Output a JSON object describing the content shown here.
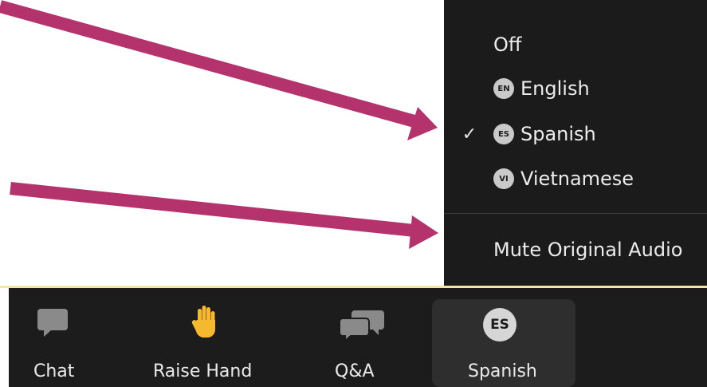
{
  "menu": {
    "items": [
      {
        "label": "Off",
        "badge": "",
        "checked": false
      },
      {
        "label": "English",
        "badge": "EN",
        "checked": false
      },
      {
        "label": "Spanish",
        "badge": "ES",
        "checked": true
      },
      {
        "label": "Vietnamese",
        "badge": "VI",
        "checked": false
      }
    ],
    "mute_label": "Mute Original Audio",
    "check_glyph": "✓"
  },
  "toolbar": {
    "chat_label": "Chat",
    "raise_hand_label": "Raise Hand",
    "qa_label": "Q&A",
    "language_badge": "ES",
    "language_label": "Spanish"
  },
  "colors": {
    "arrow": "#b5336d",
    "menu_bg": "#1b1b1b",
    "toolbar_bg": "#1c1c1c",
    "accent_line": "#f2e6a0",
    "hand_yellow": "#f5b82e"
  }
}
